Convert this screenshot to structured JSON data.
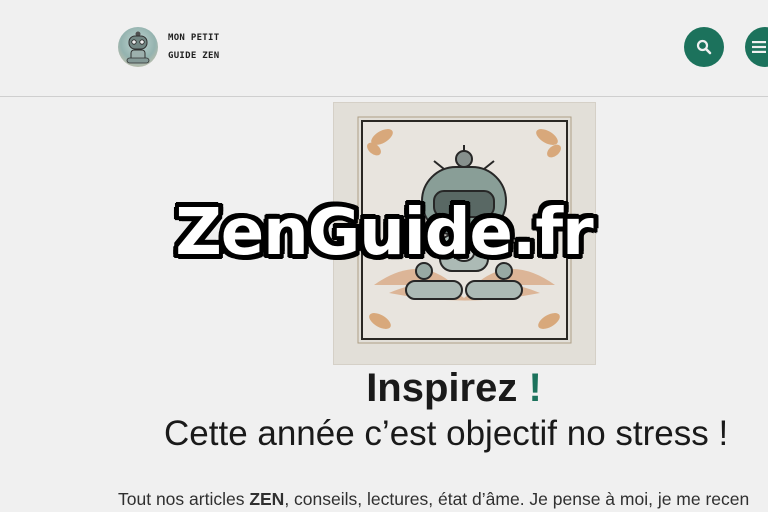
{
  "header": {
    "logo_line1": "MON PETIT",
    "logo_line2": "GUIDE ZEN",
    "search_icon": "search-icon",
    "menu_icon": "hamburger-menu-icon"
  },
  "main": {
    "headline": "Inspirez",
    "headline_accent": "!",
    "subheadline": "Cette année c’est objectif no stress !",
    "intro_prefix": "Tout nos articles ",
    "intro_bold": "ZEN",
    "intro_suffix": ", conseils, lectures, état d’âme. Je pense à moi, je me recen"
  },
  "watermark": "ZenGuide.fr",
  "colors": {
    "accent": "#1e7a62",
    "text": "#1c1c1c",
    "header_border": "#dcdcdc"
  }
}
